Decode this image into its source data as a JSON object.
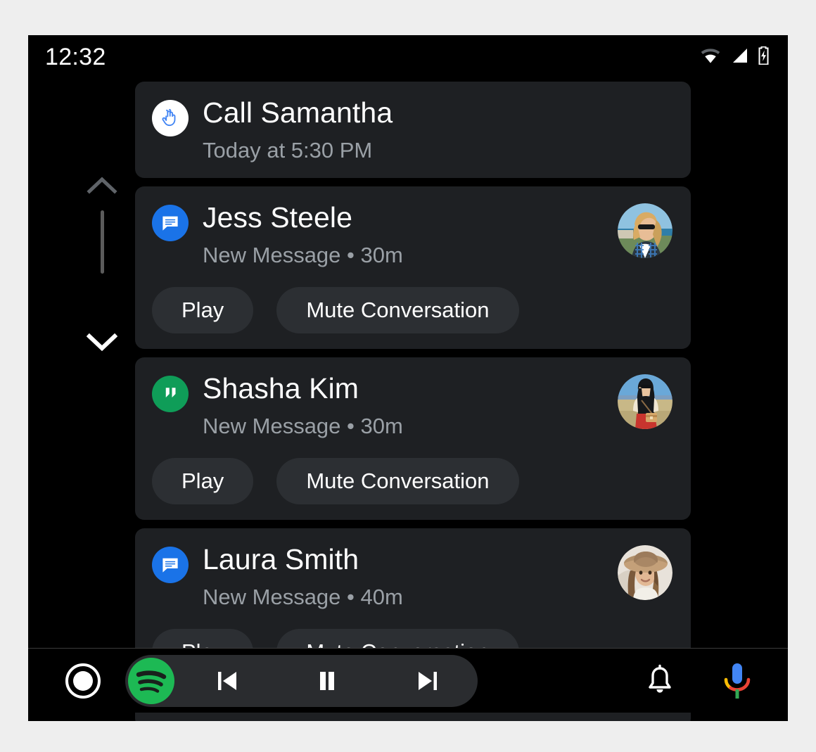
{
  "status_bar": {
    "time": "12:32",
    "icons": [
      "wifi-icon",
      "cell-signal-icon",
      "battery-charging-icon"
    ]
  },
  "scrollbar": {
    "up_icon": "chevron-up-icon",
    "down_icon": "chevron-down-icon",
    "up_enabled": false,
    "down_enabled": true
  },
  "notifications": [
    {
      "title": "Call Samantha",
      "subtitle": "Today at 5:30 PM",
      "app_icon": "reminder-hand-string-icon",
      "app_icon_style": "white",
      "has_avatar": false,
      "actions": []
    },
    {
      "title": "Jess Steele",
      "subtitle": "New Message • 30m",
      "app_icon": "messages-icon",
      "app_icon_style": "blue",
      "has_avatar": true,
      "avatar": "avatar-blonde-sunglasses-plaid",
      "actions": [
        "Play",
        "Mute Conversation"
      ]
    },
    {
      "title": "Shasha Kim",
      "subtitle": "New Message • 30m",
      "app_icon": "hangouts-icon",
      "app_icon_style": "green",
      "has_avatar": true,
      "avatar": "avatar-dark-hair-red-skirt",
      "actions": [
        "Play",
        "Mute Conversation"
      ]
    },
    {
      "title": "Laura Smith",
      "subtitle": "New Message • 40m",
      "app_icon": "messages-icon",
      "app_icon_style": "blue",
      "has_avatar": true,
      "avatar": "avatar-brown-hair-hat",
      "actions": [
        "Play",
        "Mute Conversation"
      ]
    }
  ],
  "nav_bar": {
    "home_icon": "home-circle-icon",
    "media_app_icon": "spotify-icon",
    "previous_icon": "skip-previous-icon",
    "pause_icon": "pause-icon",
    "next_icon": "skip-next-icon",
    "notifications_icon": "bell-icon",
    "assistant_icon": "google-assistant-mic-icon"
  },
  "colors": {
    "screen_background": "#000000",
    "page_background": "#eeeeee",
    "card_background": "#1e2023",
    "action_button_background": "#2c2f33",
    "primary_text": "#ffffff",
    "secondary_text": "#9aa0a6",
    "messages_blue": "#1a73e8",
    "hangouts_green": "#0f9d58",
    "spotify_green": "#1db954",
    "reminder_blue": "#4285f4"
  }
}
